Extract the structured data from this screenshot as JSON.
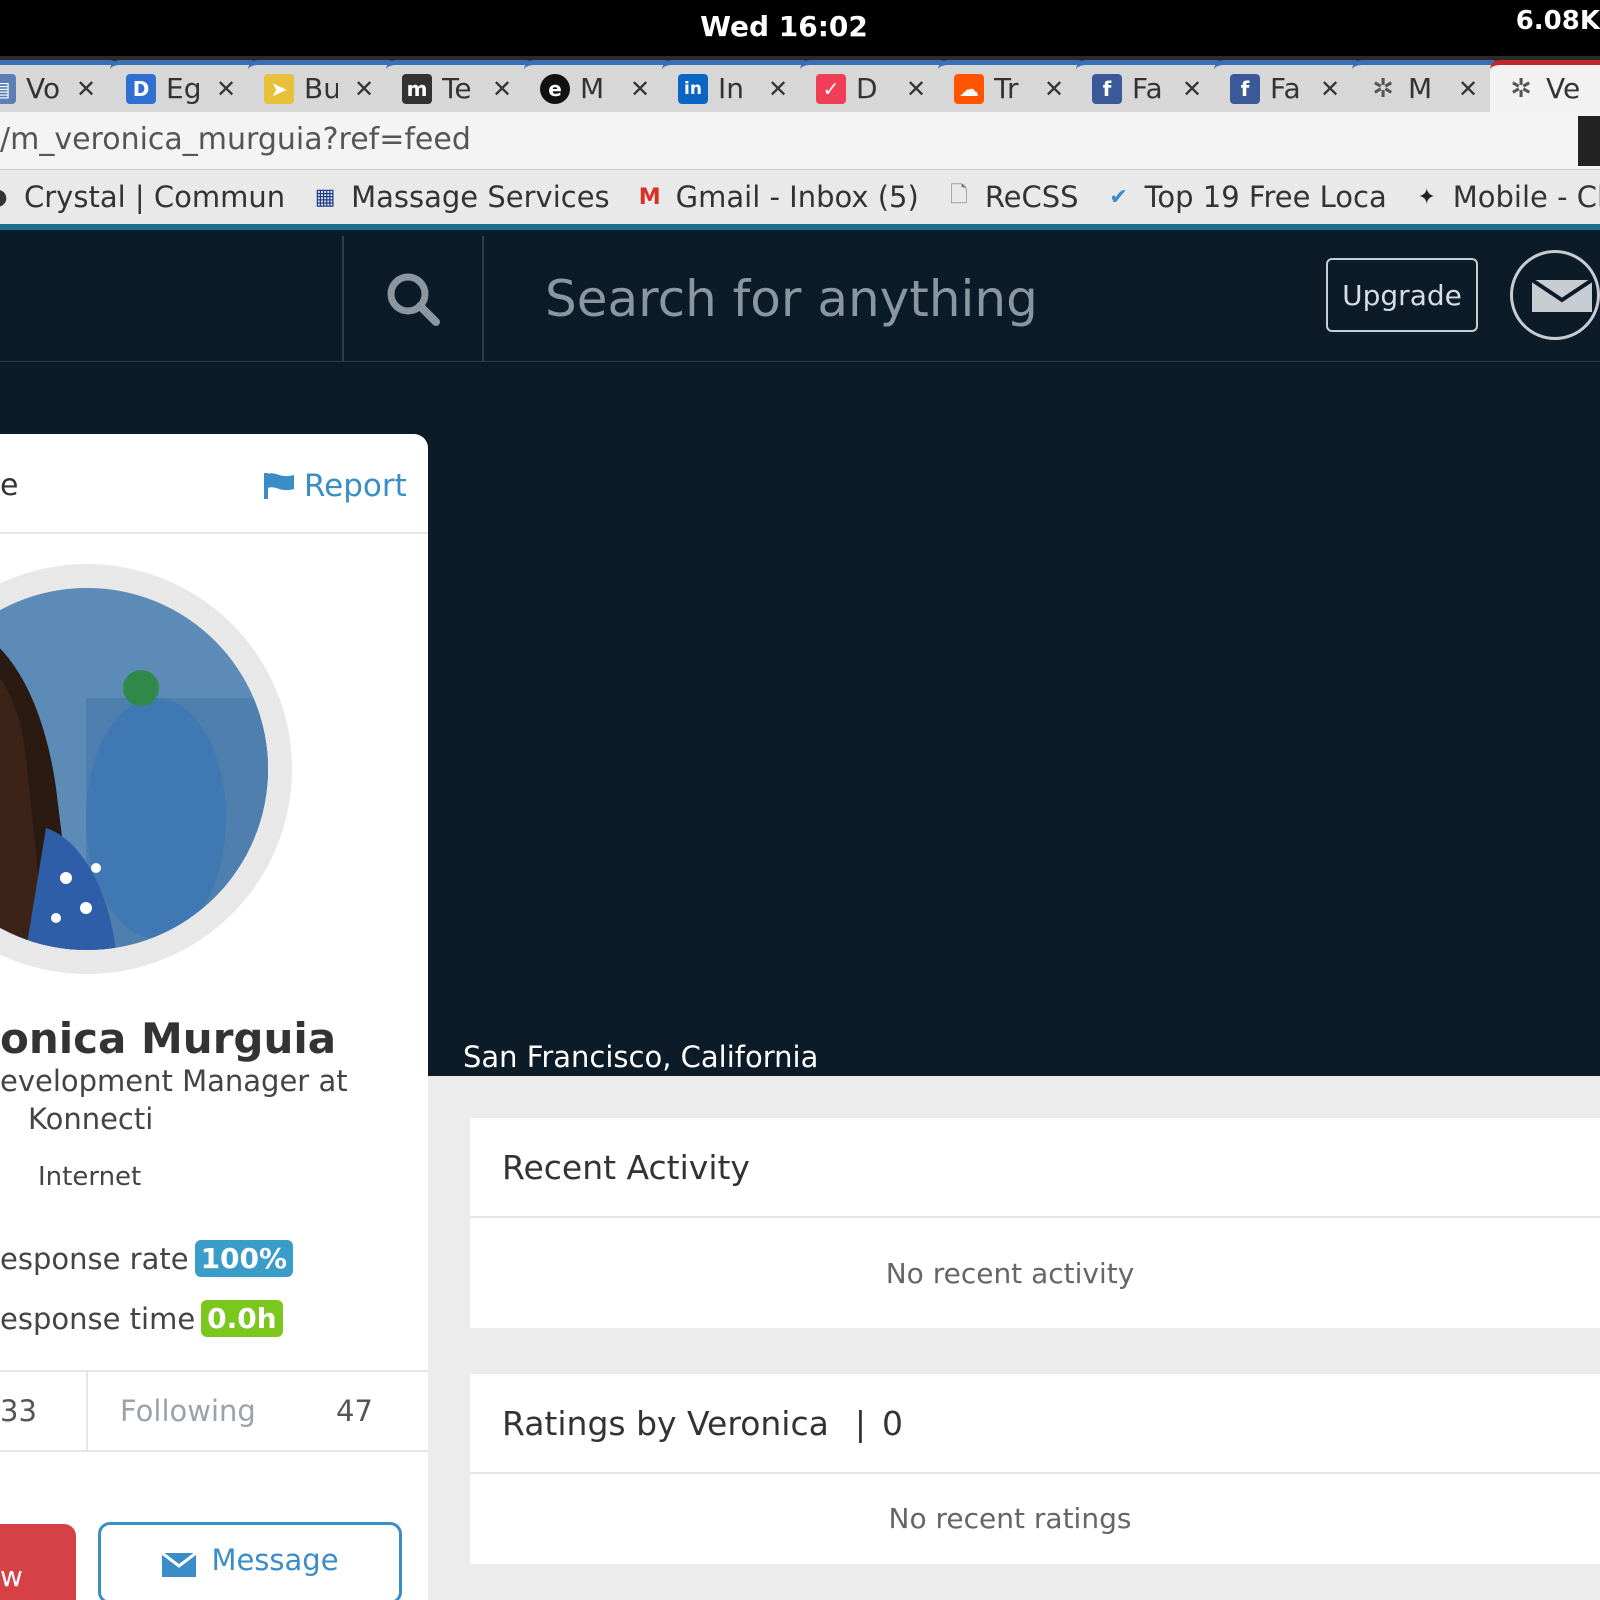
{
  "system": {
    "clock": "Wed 16:02",
    "network": "6.08K"
  },
  "tabs": [
    {
      "label": "Vo",
      "icon": "doc-icon",
      "color": "#5b7fb5",
      "glyph": "▤"
    },
    {
      "label": "Eg",
      "icon": "d-logo-icon",
      "color": "#2f6fd1",
      "glyph": "D"
    },
    {
      "label": "Bu",
      "icon": "paper-plane-icon",
      "color": "#e8c13a",
      "glyph": "➤"
    },
    {
      "label": "Te",
      "icon": "m-logo-icon",
      "color": "#333333",
      "glyph": "m"
    },
    {
      "label": "M",
      "icon": "e-logo-icon",
      "color": "#111111",
      "glyph": "e"
    },
    {
      "label": "In",
      "icon": "linkedin-icon",
      "color": "#0a66c2",
      "glyph": "in"
    },
    {
      "label": "D",
      "icon": "pocket-icon",
      "color": "#ef3e56",
      "glyph": "✓"
    },
    {
      "label": "Tr",
      "icon": "soundcloud-icon",
      "color": "#ff5500",
      "glyph": "☁"
    },
    {
      "label": "Fa",
      "icon": "facebook-icon",
      "color": "#3b5998",
      "glyph": "f"
    },
    {
      "label": "Fa",
      "icon": "facebook-icon",
      "color": "#3b5998",
      "glyph": "f"
    },
    {
      "label": "M",
      "icon": "network-icon",
      "color": "#666666",
      "glyph": "✲"
    },
    {
      "label": "Ve",
      "icon": "network-icon",
      "color": "#666666",
      "glyph": "✲"
    }
  ],
  "url": "/m_veronica_murguia?ref=feed",
  "bookmarks": [
    {
      "label": "Crystal | Commun",
      "icon": "circle-icon",
      "glyph": "●",
      "color": "#333333"
    },
    {
      "label": "Massage Services",
      "icon": "grid-icon",
      "glyph": "▦",
      "color": "#1d3f8a"
    },
    {
      "label": "Gmail - Inbox (5)",
      "icon": "gmail-icon",
      "glyph": "M",
      "color": "#d93025"
    },
    {
      "label": "ReCSS",
      "icon": "page-icon",
      "glyph": "🗋",
      "color": "#777777"
    },
    {
      "label": "Top 19 Free Loca",
      "icon": "check-badge-icon",
      "glyph": "✔",
      "color": "#3a8dc6"
    },
    {
      "label": "Mobile - Clea",
      "icon": "bird-icon",
      "glyph": "✦",
      "color": "#222222"
    }
  ],
  "header": {
    "search_placeholder": "Search for anything",
    "upgrade_label": "Upgrade"
  },
  "profile": {
    "tab_fragment": "e",
    "report_label": "Report",
    "name": "onica Murguia",
    "title_line1": "evelopment Manager at",
    "title_line2": "Konnecti",
    "industry": "Internet",
    "response_rate_label": "esponse rate",
    "response_rate": "100%",
    "response_time_label": "esponse time",
    "response_time": "0.0h",
    "followers_count": "33",
    "following_label": "Following",
    "following_count": "47",
    "follow_label": "w",
    "message_label": "Message",
    "location": "San Francisco, California"
  },
  "activity": {
    "title": "Recent Activity",
    "empty": "No recent activity"
  },
  "ratings": {
    "title": "Ratings by Veronica",
    "count": "0",
    "empty": "No recent ratings"
  },
  "colors": {
    "accent": "#3a8dc6",
    "rate_badge": "#3a9cc8",
    "time_badge": "#7bc71e",
    "follow": "#d54145",
    "header_bg": "#0b1b28"
  }
}
